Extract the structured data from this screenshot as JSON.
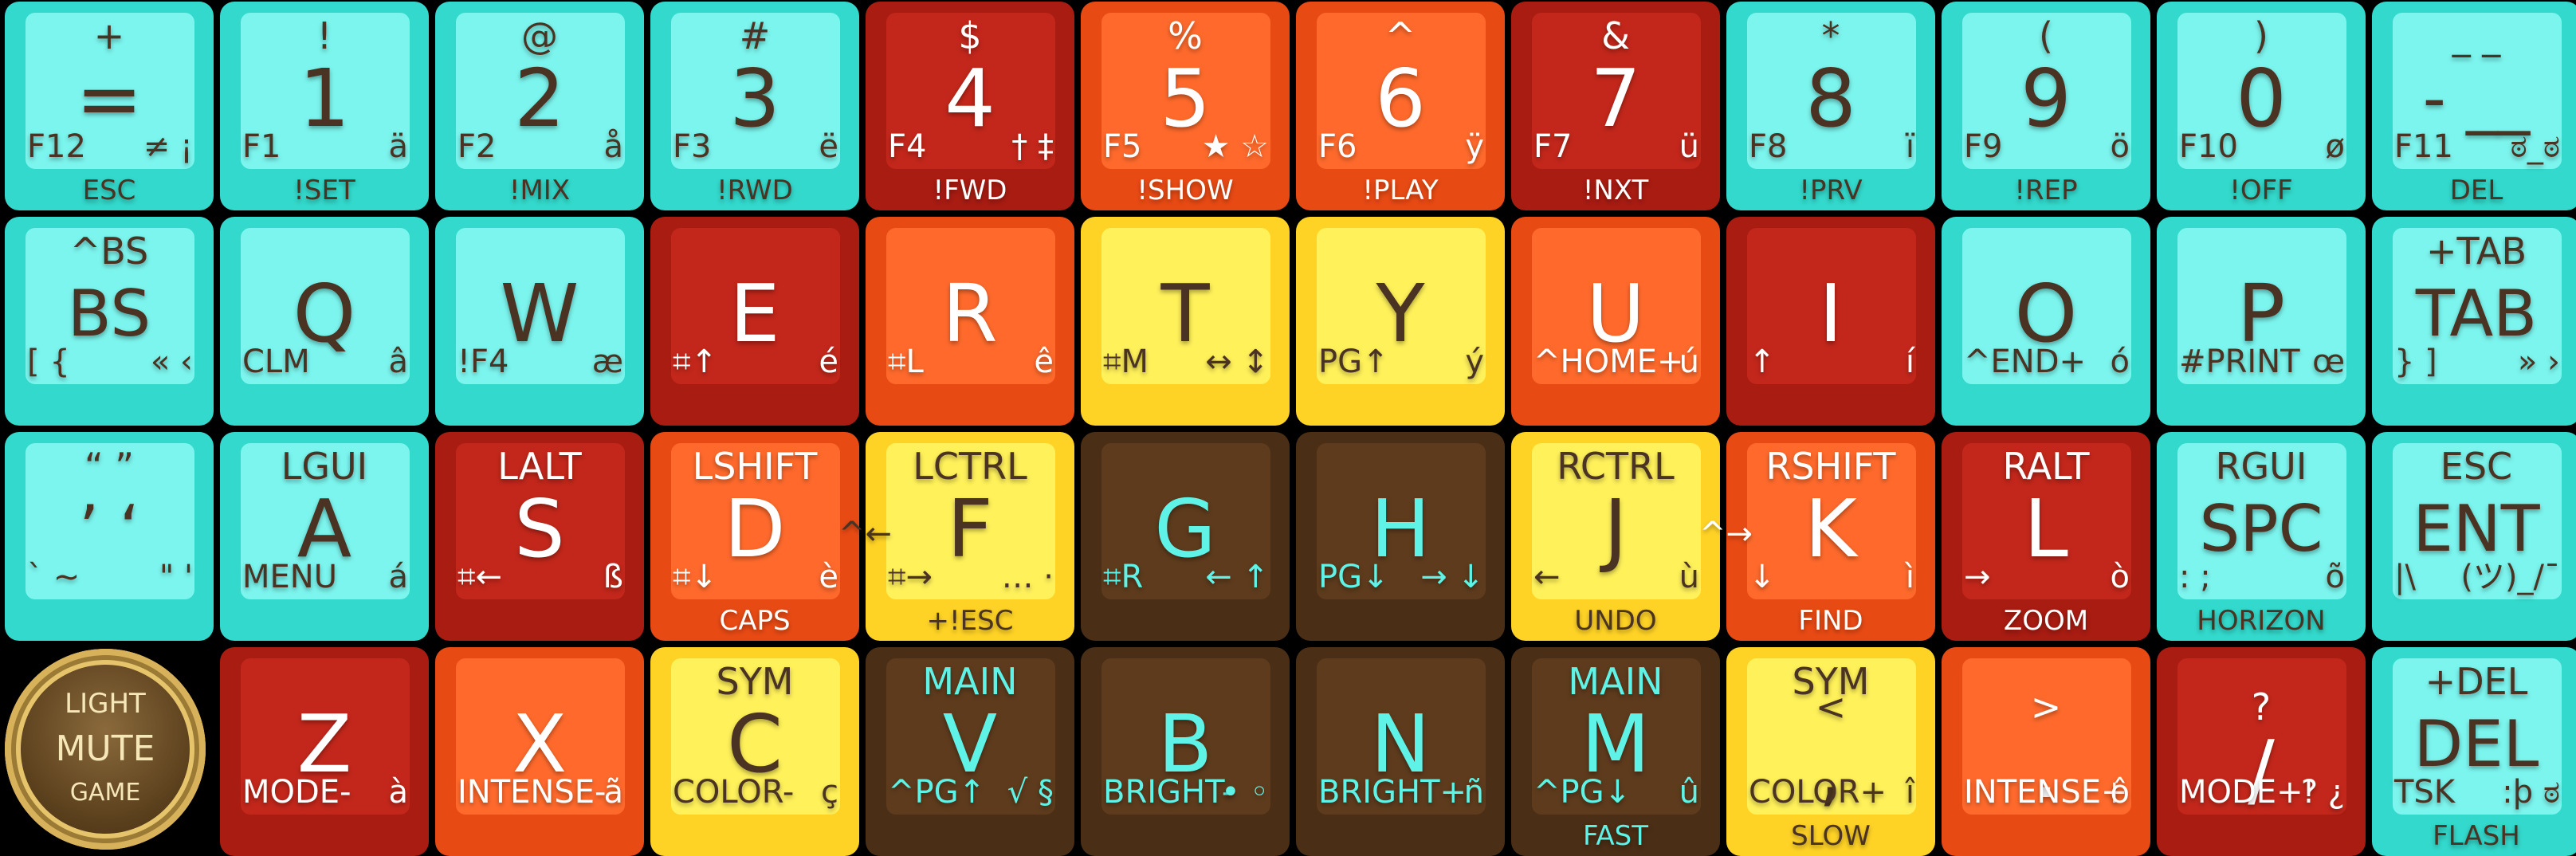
{
  "theme": {
    "cyan": {
      "outer": "#33d9cc",
      "inner": "#7cf5ee",
      "text": "#4a3322",
      "sub": "#4a3322"
    },
    "red": {
      "outer": "#a81c12",
      "inner": "#c3271b",
      "text": "#ffffff",
      "sub": "#ffffff"
    },
    "orange": {
      "outer": "#e84a14",
      "inner": "#ff6a2c",
      "text": "#ffffff",
      "sub": "#ffffff"
    },
    "yellow": {
      "outer": "#ffd326",
      "inner": "#fff15a",
      "text": "#4a3322",
      "sub": "#4a3322"
    },
    "brown": {
      "outer": "#4a2e15",
      "inner": "#5e3b1d",
      "text": "#5ff2e6",
      "sub": "#5ff2e6"
    }
  },
  "knob": {
    "top": "LIGHT",
    "mid": "MUTE",
    "bot": "GAME"
  },
  "keys": [
    {
      "id": "key-equals",
      "row": 0,
      "col": 0,
      "color": "cyan",
      "top": "+",
      "main": "=",
      "bl": "F12",
      "br": "≠ ¡",
      "bot": "ESC"
    },
    {
      "id": "key-1",
      "row": 0,
      "col": 1,
      "color": "cyan",
      "top": "!",
      "main": "1",
      "bl": "F1",
      "br": "ä",
      "bot": "!SET"
    },
    {
      "id": "key-2",
      "row": 0,
      "col": 2,
      "color": "cyan",
      "top": "@",
      "main": "2",
      "bl": "F2",
      "br": "å",
      "bot": "!MIX"
    },
    {
      "id": "key-3",
      "row": 0,
      "col": 3,
      "color": "cyan",
      "top": "#",
      "main": "3",
      "bl": "F3",
      "br": "ë",
      "bot": "!RWD"
    },
    {
      "id": "key-4",
      "row": 0,
      "col": 4,
      "color": "red",
      "top": "$",
      "main": "4",
      "bl": "F4",
      "br": "† ‡",
      "bot": "!FWD"
    },
    {
      "id": "key-5",
      "row": 0,
      "col": 5,
      "color": "orange",
      "top": "%",
      "main": "5",
      "bl": "F5",
      "br": "★ ☆",
      "bot": "!SHOW"
    },
    {
      "id": "key-6",
      "row": 0,
      "col": 6,
      "color": "orange",
      "top": "^",
      "main": "6",
      "bl": "F6",
      "br": "ÿ",
      "bot": "!PLAY"
    },
    {
      "id": "key-7",
      "row": 0,
      "col": 7,
      "color": "red",
      "top": "&",
      "main": "7",
      "bl": "F7",
      "br": "ü",
      "bot": "!NXT"
    },
    {
      "id": "key-8",
      "row": 0,
      "col": 8,
      "color": "cyan",
      "top": "*",
      "main": "8",
      "bl": "F8",
      "br": "ï",
      "bot": "!PRV"
    },
    {
      "id": "key-9",
      "row": 0,
      "col": 9,
      "color": "cyan",
      "top": "(",
      "main": "9",
      "bl": "F9",
      "br": "ö",
      "bot": "!REP"
    },
    {
      "id": "key-0",
      "row": 0,
      "col": 10,
      "color": "cyan",
      "top": ")",
      "main": "0",
      "bl": "F10",
      "br": "ø",
      "bot": "!OFF"
    },
    {
      "id": "key-minus",
      "row": 0,
      "col": 11,
      "color": "cyan",
      "top": "_ _",
      "main": "- __",
      "bl": "F11",
      "br": "ಠ_ಠ",
      "bot": "DEL",
      "mid": true
    },
    {
      "id": "key-bs",
      "row": 1,
      "col": 0,
      "color": "cyan",
      "top": "^BS",
      "main": "BS",
      "bl": "[ {",
      "br": "« ‹",
      "bot": "",
      "mid": true
    },
    {
      "id": "key-q",
      "row": 1,
      "col": 1,
      "color": "cyan",
      "top": "",
      "main": "Q",
      "bl": "CLM",
      "br": "â",
      "bot": ""
    },
    {
      "id": "key-w",
      "row": 1,
      "col": 2,
      "color": "cyan",
      "top": "",
      "main": "W",
      "bl": "!F4",
      "br": "æ",
      "bot": ""
    },
    {
      "id": "key-e",
      "row": 1,
      "col": 3,
      "color": "red",
      "top": "",
      "main": "E",
      "bl": "⌗↑",
      "br": "é",
      "bot": ""
    },
    {
      "id": "key-r",
      "row": 1,
      "col": 4,
      "color": "orange",
      "top": "",
      "main": "R",
      "bl": "⌗L",
      "br": "ê",
      "bot": ""
    },
    {
      "id": "key-t",
      "row": 1,
      "col": 5,
      "color": "yellow",
      "top": "",
      "main": "T",
      "bl": "⌗M",
      "br": "↔ ↕",
      "bot": ""
    },
    {
      "id": "key-y",
      "row": 1,
      "col": 6,
      "color": "yellow",
      "top": "",
      "main": "Y",
      "bl": "PG↑",
      "br": "ý",
      "bot": ""
    },
    {
      "id": "key-u",
      "row": 1,
      "col": 7,
      "color": "orange",
      "top": "",
      "main": "U",
      "bl": "^HOME+",
      "br": "ú",
      "bot": ""
    },
    {
      "id": "key-i",
      "row": 1,
      "col": 8,
      "color": "red",
      "top": "",
      "main": "I",
      "bl": "↑",
      "br": "í",
      "bot": ""
    },
    {
      "id": "key-o",
      "row": 1,
      "col": 9,
      "color": "cyan",
      "top": "",
      "main": "O",
      "bl": "^END+",
      "br": "ó",
      "bot": ""
    },
    {
      "id": "key-p",
      "row": 1,
      "col": 10,
      "color": "cyan",
      "top": "",
      "main": "P",
      "bl": "#PRINT",
      "br": "œ",
      "bot": ""
    },
    {
      "id": "key-tab",
      "row": 1,
      "col": 11,
      "color": "cyan",
      "top": "+TAB",
      "main": "TAB",
      "bl": "} ]",
      "br": "» ›",
      "bot": "",
      "mid": true
    },
    {
      "id": "key-quote",
      "row": 2,
      "col": 0,
      "color": "cyan",
      "top": "“ ”",
      "main": "’ ‘",
      "bl": "` ~",
      "br": "\" '",
      "bot": "",
      "mid": true
    },
    {
      "id": "key-a",
      "row": 2,
      "col": 1,
      "color": "cyan",
      "top": "LGUI",
      "main": "A",
      "bl": "MENU",
      "br": "á",
      "bot": ""
    },
    {
      "id": "key-s",
      "row": 2,
      "col": 2,
      "color": "red",
      "top": "LALT",
      "main": "S",
      "bl": "⌗←",
      "br": "ß",
      "bot": ""
    },
    {
      "id": "key-d",
      "row": 2,
      "col": 3,
      "color": "orange",
      "top": "LSHIFT",
      "main": "D",
      "bl": "⌗↓",
      "br": "è",
      "bot": "CAPS"
    },
    {
      "id": "key-f",
      "row": 2,
      "col": 4,
      "color": "yellow",
      "top": "LCTRL",
      "main": "F",
      "bl": "⌗→",
      "br": "… ·",
      "bot": "+!ESC",
      "side": "^←"
    },
    {
      "id": "key-g",
      "row": 2,
      "col": 5,
      "color": "brown",
      "top": "",
      "main": "G",
      "bl": "⌗R",
      "br": "← ↑",
      "bot": ""
    },
    {
      "id": "key-h",
      "row": 2,
      "col": 6,
      "color": "brown",
      "top": "",
      "main": "H",
      "bl": "PG↓",
      "br": "→ ↓",
      "bot": ""
    },
    {
      "id": "key-j",
      "row": 2,
      "col": 7,
      "color": "yellow",
      "top": "RCTRL",
      "main": "J",
      "bl": "←",
      "br": "ù",
      "bot": "UNDO"
    },
    {
      "id": "key-k",
      "row": 2,
      "col": 8,
      "color": "orange",
      "top": "RSHIFT",
      "main": "K",
      "bl": "↓",
      "br": "ì",
      "bot": "FIND",
      "side": "^→"
    },
    {
      "id": "key-l",
      "row": 2,
      "col": 9,
      "color": "red",
      "top": "RALT",
      "main": "L",
      "bl": "→",
      "br": "ò",
      "bot": "ZOOM"
    },
    {
      "id": "key-spc",
      "row": 2,
      "col": 10,
      "color": "cyan",
      "top": "RGUI",
      "main": "SPC",
      "bl": ": ;",
      "br": "õ",
      "bot": "HORIZON",
      "mid": true
    },
    {
      "id": "key-ent",
      "row": 2,
      "col": 11,
      "color": "cyan",
      "top": "ESC",
      "main": "ENT",
      "bl": "|\\",
      "br": "(ツ)_/¯",
      "bot": "",
      "mid": true
    },
    {
      "id": "key-z",
      "row": 3,
      "col": 1,
      "color": "red",
      "top": "",
      "main": "Z",
      "bl": "MODE-",
      "br": "à",
      "bot": ""
    },
    {
      "id": "key-x",
      "row": 3,
      "col": 2,
      "color": "orange",
      "top": "",
      "main": "X",
      "bl": "INTENSE-",
      "br": "ã",
      "bot": ""
    },
    {
      "id": "key-c",
      "row": 3,
      "col": 3,
      "color": "yellow",
      "top": "SYM",
      "main": "C",
      "bl": "COLOR-",
      "br": "ç",
      "bot": ""
    },
    {
      "id": "key-v",
      "row": 3,
      "col": 4,
      "color": "brown",
      "top": "MAIN",
      "main": "V",
      "bl": "^PG↑",
      "br": "√ §",
      "bot": ""
    },
    {
      "id": "key-b",
      "row": 3,
      "col": 5,
      "color": "brown",
      "top": "",
      "main": "B",
      "bl": "BRIGHT-",
      "br": "• ◦",
      "bot": ""
    },
    {
      "id": "key-n",
      "row": 3,
      "col": 6,
      "color": "brown",
      "top": "",
      "main": "N",
      "bl": "BRIGHT+",
      "br": "ñ",
      "bot": ""
    },
    {
      "id": "key-m",
      "row": 3,
      "col": 7,
      "color": "brown",
      "top": "MAIN",
      "main": "M",
      "bl": "^PG↓",
      "br": "û",
      "bot": "FAST"
    },
    {
      "id": "key-comma",
      "row": 3,
      "col": 8,
      "color": "yellow",
      "top": "SYM",
      "main": ",",
      "bl": "COLOR+",
      "br": "î",
      "bot": "SLOW",
      "sub": "<"
    },
    {
      "id": "key-period",
      "row": 3,
      "col": 9,
      "color": "orange",
      "top": "",
      "main": ".",
      "bl": "INTENSE+",
      "br": "ô",
      "bot": "",
      "sub": ">"
    },
    {
      "id": "key-slash",
      "row": 3,
      "col": 10,
      "color": "red",
      "top": "",
      "main": "/",
      "bl": "MODE+",
      "br": "‽ ¿",
      "bot": "",
      "sub": "?"
    },
    {
      "id": "key-del",
      "row": 3,
      "col": 11,
      "color": "cyan",
      "top": "+DEL",
      "main": "DEL",
      "bl": "TSK",
      "br": ":þ ಠ",
      "bot": "FLASH",
      "mid": true
    }
  ]
}
